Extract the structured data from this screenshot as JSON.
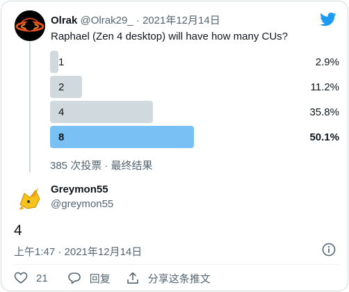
{
  "tweet1": {
    "display_name": "Olrak",
    "handle": "@Olrak29_",
    "separator": " · ",
    "date": "2021年12月14日",
    "question": "Raphael (Zen 4 desktop) will have how many CUs?"
  },
  "poll": {
    "options": [
      {
        "label": "1",
        "percent": "2.9%",
        "value": 0.029,
        "winner": false
      },
      {
        "label": "2",
        "percent": "11.2%",
        "value": 0.112,
        "winner": false
      },
      {
        "label": "4",
        "percent": "35.8%",
        "value": 0.358,
        "winner": false
      },
      {
        "label": "8",
        "percent": "50.1%",
        "value": 0.501,
        "winner": true
      }
    ],
    "footer": "385 次投票 · 最终结果"
  },
  "tweet2": {
    "display_name": "Greymon55",
    "handle": "@greymon55",
    "text": "4",
    "meta": "上午1:47 · 2021年12月14日"
  },
  "actions": {
    "like_count": "21",
    "reply_label": "回复",
    "share_label": "分享这条推文"
  },
  "colors": {
    "accent": "#1d9bf0",
    "bar": "#cfd9de",
    "bar_winner": "#79c1f5",
    "muted": "#536471"
  }
}
